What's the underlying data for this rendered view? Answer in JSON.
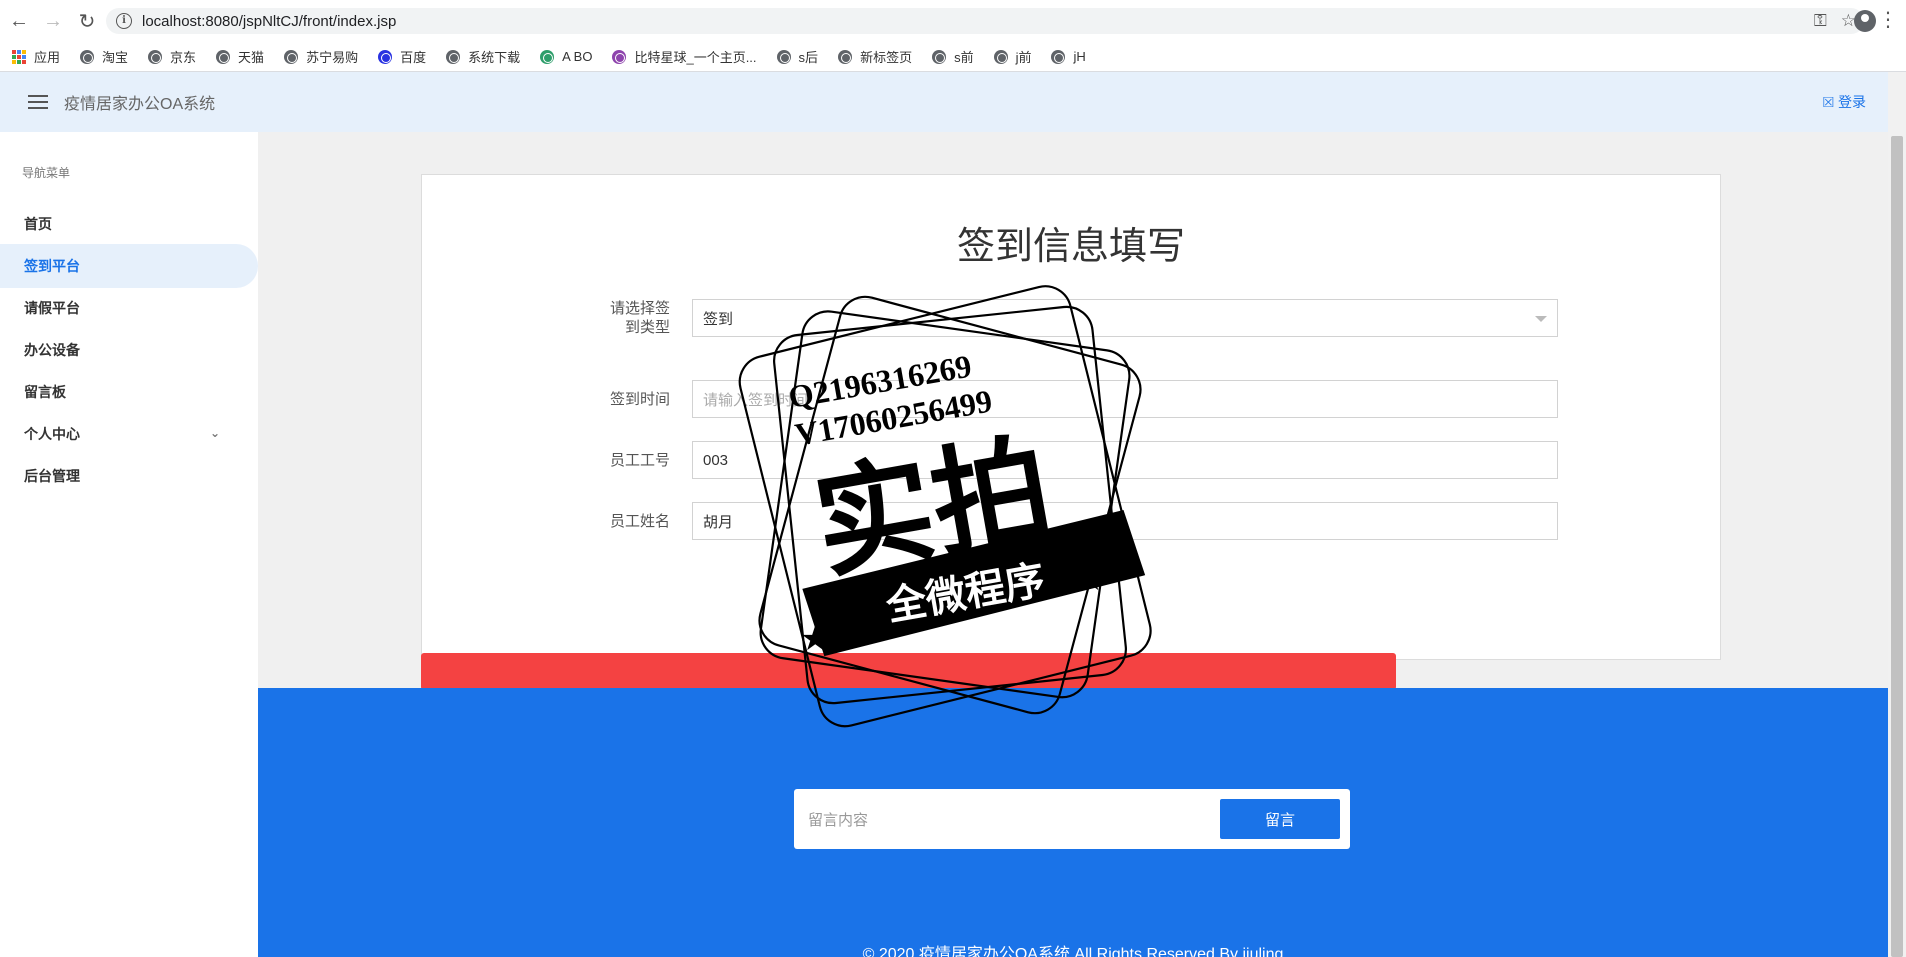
{
  "browser": {
    "url": "localhost:8080/jspNltCJ/front/index.jsp",
    "bookmarks": [
      {
        "label": "应用",
        "icon": "apps-grid-icon"
      },
      {
        "label": "淘宝",
        "icon": "globe-icon"
      },
      {
        "label": "京东",
        "icon": "globe-icon"
      },
      {
        "label": "天猫",
        "icon": "globe-icon"
      },
      {
        "label": "苏宁易购",
        "icon": "globe-icon"
      },
      {
        "label": "百度",
        "icon": "baidu-paw-icon"
      },
      {
        "label": "系统下载",
        "icon": "globe-icon"
      },
      {
        "label": "A BO",
        "icon": "leaf-icon"
      },
      {
        "label": "比特星球_一个主页...",
        "icon": "planet-icon"
      },
      {
        "label": "s后",
        "icon": "globe-icon"
      },
      {
        "label": "新标签页",
        "icon": "globe-icon"
      },
      {
        "label": "s前",
        "icon": "globe-icon"
      },
      {
        "label": "j前",
        "icon": "globe-icon"
      },
      {
        "label": "jH",
        "icon": "globe-icon"
      }
    ]
  },
  "header": {
    "title": "疫情居家办公OA系统",
    "login_label": "登录"
  },
  "sidebar": {
    "caption": "导航菜单",
    "items": [
      {
        "label": "首页",
        "active": false
      },
      {
        "label": "签到平台",
        "active": true
      },
      {
        "label": "请假平台",
        "active": false
      },
      {
        "label": "办公设备",
        "active": false
      },
      {
        "label": "留言板",
        "active": false
      },
      {
        "label": "个人中心",
        "active": false,
        "expandable": true
      },
      {
        "label": "后台管理",
        "active": false
      }
    ]
  },
  "form": {
    "title": "签到信息填写",
    "fields": {
      "type_label": "请选择签到类型",
      "type_value": "签到",
      "time_label": "签到时间",
      "time_placeholder": "请输入签到时间",
      "emp_id_label": "员工工号",
      "emp_id_value": "003",
      "emp_name_label": "员工姓名",
      "emp_name_value": "胡月"
    }
  },
  "footer": {
    "message_placeholder": "留言内容",
    "message_button": "留言",
    "copyright": "© 2020 疫情居家办公OA系统 All Rights Reserved By jiuling"
  },
  "watermark": {
    "line1": "Q2196316269",
    "line2": "V17060256499",
    "main": "实拍",
    "banner": "全微程序"
  },
  "colors": {
    "accent": "#1a73e8",
    "header_bg": "#e6f0fb",
    "submit_red": "#f44242",
    "content_bg": "#f0f0f0"
  }
}
